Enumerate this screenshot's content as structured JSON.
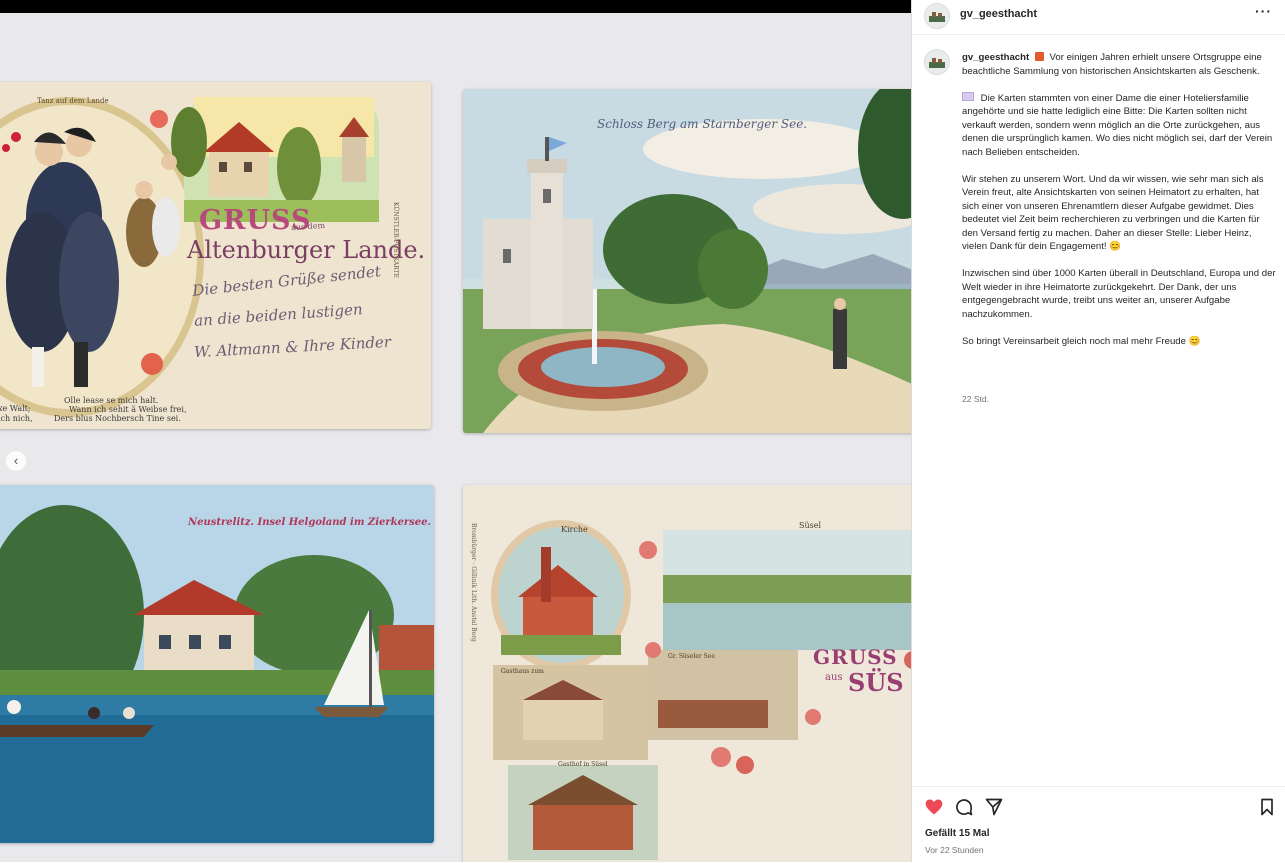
{
  "post": {
    "username": "gv_geesthacht",
    "caption": {
      "intro": "Vor einigen Jahren erhielt unsere Ortsgruppe eine beachtliche Sammlung von historischen Ansichtskarten als Geschenk.",
      "para1": "Die Karten stammten von einer Dame die einer Hoteliersfamilie angehörte und sie hatte lediglich eine Bitte: Die Karten sollten nicht verkauft werden, sondern wenn möglich an die Orte zurückgehen, aus denen die ursprünglich kamen. Wo dies nicht möglich sei, darf der Verein nach Belieben entscheiden.",
      "para2": "Wir stehen zu unserem Wort. Und da wir wissen, wie sehr man sich als Verein freut, alte Ansichtskarten von seinen Heimatort zu erhalten, hat sich einer von unseren Ehrenamtlern dieser Aufgabe gewidmet. Dies bedeutet viel Zeit beim recherchieren zu verbringen und die Karten für den Versand fertig zu machen. Daher an dieser Stelle: Lieber Heinz, vielen Dank für dein Engagement! 😊",
      "para3": "Inzwischen sind über 1000 Karten überall in Deutschland, Europa und der Welt wieder in ihre Heimatorte zurückgekehrt. Der Dank, der uns entgegengebracht wurde, treibt uns weiter an, unserer Aufgabe nachzukommen.",
      "para4": "So bringt Vereinsarbeit gleich noch mal mehr Freude 😊"
    },
    "caption_time": "22 Std.",
    "likes": "Gefällt 15 Mal",
    "time_ago": "Vor 22 Stunden",
    "liked_color": "#ed4956"
  },
  "photo": {
    "card1": {
      "banner": "Tanz auf dem Lande",
      "gruss": "GRUSS",
      "aus": "aus dem",
      "place": "Altenburger Lande.",
      "side": "KÜNSTLER-POSTKARTE",
      "hand1": "Die besten Grüße sendet",
      "hand2": "an die beiden lustigen",
      "hand3": "W. Altmann & Ihre Kinder",
      "verse1": "Olle lease se mich halt.",
      "verse2": "Wann ich sehit ä Weibse frei,",
      "verse3": "Ders blus Nochbersch Tine sei.",
      "verse_left1": "xe Walt;",
      "verse_left2": "ich nich,"
    },
    "card2": {
      "title": "Schloss Berg am Starnberger See."
    },
    "card3": {
      "title": "Neustrelitz.  Insel Helgoland im Zierkersee."
    },
    "card4": {
      "label_kirche": "Kirche",
      "label_suesel": "Süsel",
      "label_gasthaus": "Gasthaus zum",
      "label_see": "Gr. Süseler See",
      "label_gasthof": "Gasthof in Süsel",
      "gruss": "GRUSS",
      "aus": "aus",
      "place": "SÜS",
      "side_text": "Brombürger - Gillinik Lith. Anstal Berg"
    },
    "prev_icon": "chevron-left-icon"
  },
  "icons": [
    "more-icon",
    "heart-icon",
    "comment-icon",
    "share-icon",
    "bookmark-icon"
  ]
}
